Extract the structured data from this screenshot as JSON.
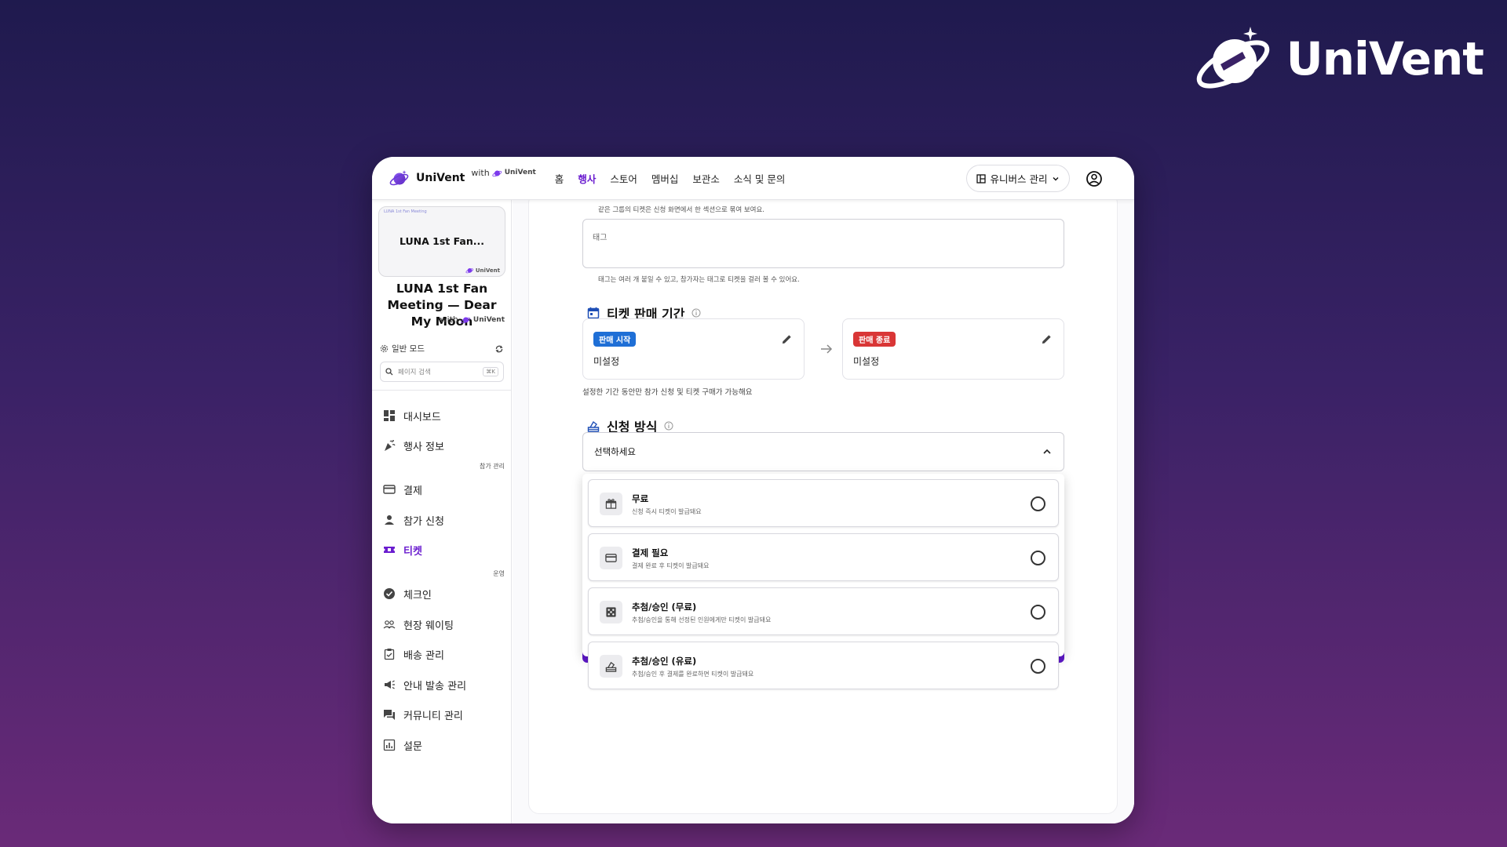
{
  "brand": {
    "name": "UniVent"
  },
  "topbar": {
    "title": "UniVent",
    "with_label": "with",
    "with_brand": "UniVent",
    "nav": [
      {
        "label": "홈",
        "active": false
      },
      {
        "label": "행사",
        "active": true
      },
      {
        "label": "스토어",
        "active": false
      },
      {
        "label": "멤버십",
        "active": false
      },
      {
        "label": "보관소",
        "active": false
      },
      {
        "label": "소식 및 문의",
        "active": false
      }
    ],
    "universe_button": "유니버스 관리"
  },
  "sidebar": {
    "card_tiny": "LUNA 1st Fan Meeting",
    "card_title": "LUNA 1st Fan...",
    "card_brand": "UniVent",
    "event_title": "LUNA 1st Fan Meeting — Dear My Moon",
    "with_label": "with",
    "with_brand": "UniVent",
    "mode": "일반 모드",
    "search_placeholder": "페이지 검색",
    "search_kbd": "⌘K",
    "section_participation": "참가 관리",
    "section_operation": "운영",
    "items": [
      {
        "label": "대시보드",
        "icon": "dashboard-icon"
      },
      {
        "label": "행사 정보",
        "icon": "celebration-icon"
      },
      {
        "label": "결제",
        "icon": "credit-card-icon"
      },
      {
        "label": "참가 신청",
        "icon": "person-icon"
      },
      {
        "label": "티켓",
        "icon": "ticket-icon"
      },
      {
        "label": "체크인",
        "icon": "check-circle-icon"
      },
      {
        "label": "현장 웨이팅",
        "icon": "group-icon"
      },
      {
        "label": "배송 관리",
        "icon": "clipboard-icon"
      },
      {
        "label": "안내 발송 관리",
        "icon": "campaign-icon"
      },
      {
        "label": "커뮤니티 관리",
        "icon": "forum-icon"
      },
      {
        "label": "설문",
        "icon": "poll-icon"
      }
    ]
  },
  "main": {
    "group_hint": "같은 그룹의 티켓은 신청 화면에서 한 섹션으로 묶여 보여요.",
    "tag_placeholder": "태그",
    "tag_hint": "태그는 여러 개 붙일 수 있고, 참가자는 태그로 티켓을 걸러 볼 수 있어요.",
    "sale_period": {
      "title": "티켓 판매 기간",
      "start_badge": "판매 시작",
      "start_value": "미설정",
      "end_badge": "판매 종료",
      "end_value": "미설정",
      "hint": "설정한 기간 동안만 참가 신청 및 티켓 구매가 가능해요",
      "start_color": "#1f6fd6",
      "end_color": "#d93636"
    },
    "application": {
      "title": "신청 방식",
      "select_placeholder": "선택하세요",
      "options": [
        {
          "title": "무료",
          "desc": "신청 즉시 티켓이 발급돼요",
          "icon": "gift-icon"
        },
        {
          "title": "결제 필요",
          "desc": "결제 완료 후 티켓이 발급돼요",
          "icon": "credit-card-icon"
        },
        {
          "title": "추첨/승인 (무료)",
          "desc": "추첨/승인을 통해 선정된 인원에게만 티켓이 발급돼요",
          "icon": "casino-icon"
        },
        {
          "title": "추첨/승인 (유료)",
          "desc": "추첨/승인 후 결제를 완료하면 티켓이 발급돼요",
          "icon": "ballot-icon"
        }
      ]
    }
  },
  "colors": {
    "accent": "#6a1ccf",
    "background_top": "#1f1a4e",
    "background_bottom": "#6a2a78"
  }
}
